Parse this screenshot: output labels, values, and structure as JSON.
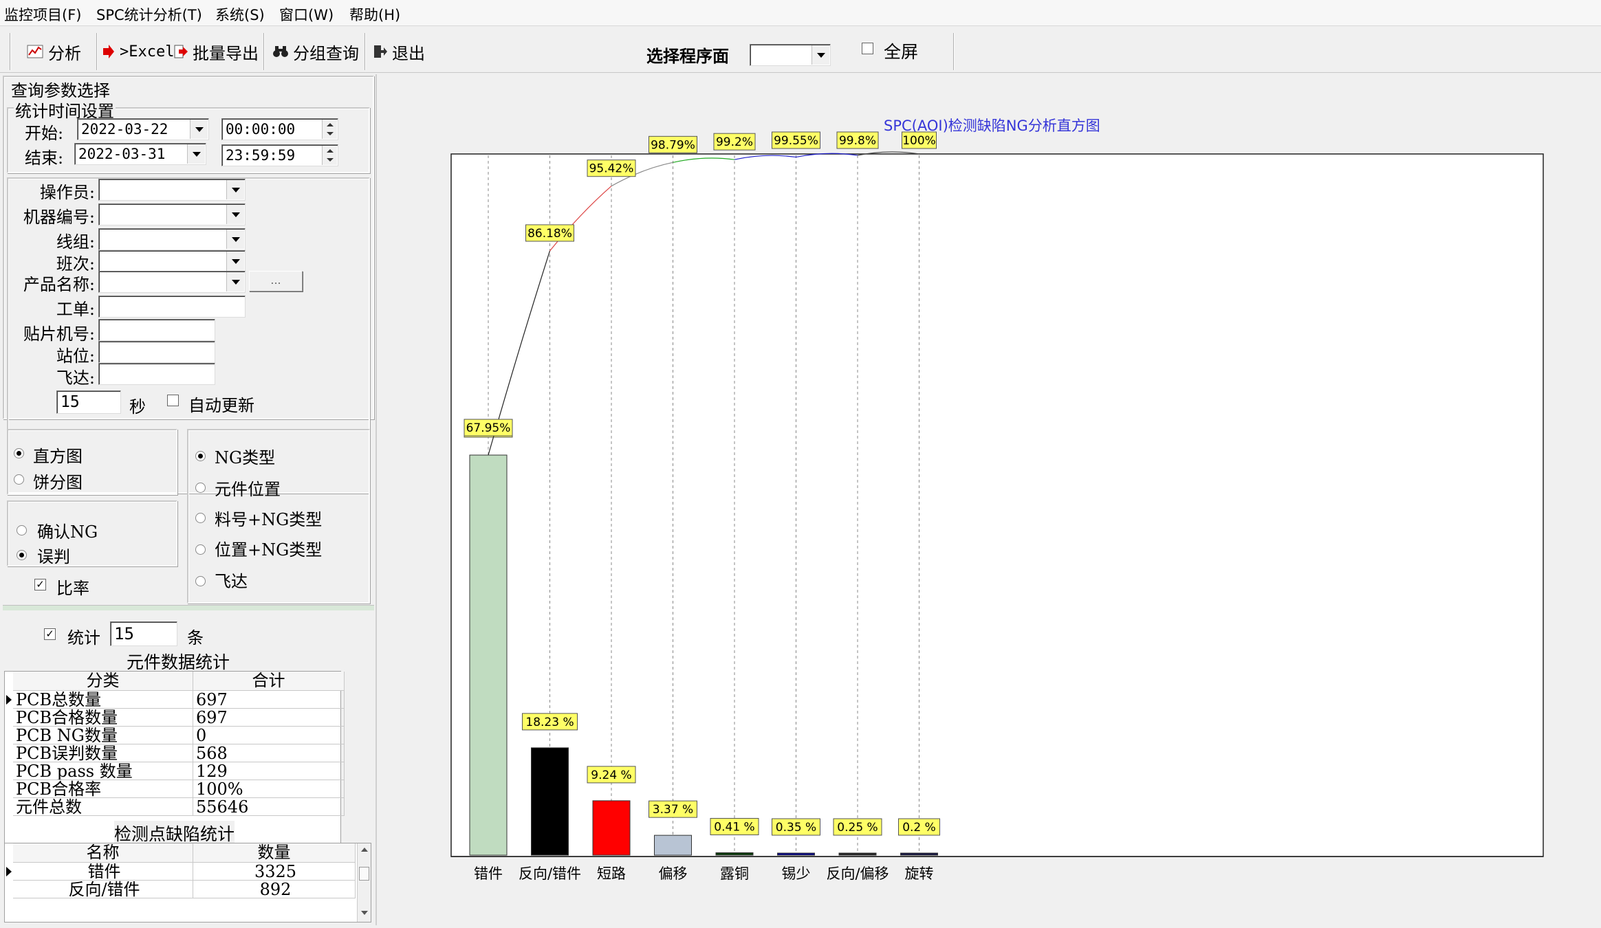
{
  "menu": [
    "监控项目(F)",
    "SPC统计分析(T)",
    "系统(S)",
    "窗口(W)",
    "帮助(H)"
  ],
  "toolbar": {
    "analyze": "分析",
    "excel": ">Excel",
    "batch_export": "批量导出",
    "group_query": "分组查询",
    "exit": "退出",
    "program_side_label": "选择程序面",
    "program_side_value": "",
    "fullscreen_label": "全屏",
    "fullscreen_checked": false
  },
  "query": {
    "title": "查询参数选择",
    "time_title": "统计时间设置",
    "start_label": "开始:",
    "start_date": "2022-03-22",
    "start_time": "00:00:00",
    "end_label": "结束:",
    "end_date": "2022-03-31",
    "end_time": "23:59:59",
    "fields": [
      {
        "label": "操作员:",
        "type": "select",
        "value": ""
      },
      {
        "label": "机器编号:",
        "type": "select",
        "value": ""
      },
      {
        "label": "线组:",
        "type": "select",
        "value": ""
      },
      {
        "label": "班次:",
        "type": "select",
        "value": ""
      },
      {
        "label": "产品名称:",
        "type": "select",
        "value": ""
      },
      {
        "label": "工单:",
        "type": "text",
        "value": ""
      },
      {
        "label": "贴片机号:",
        "type": "text",
        "value": ""
      },
      {
        "label": "站位:",
        "type": "text",
        "value": ""
      },
      {
        "label": "飞达:",
        "type": "text",
        "value": ""
      }
    ],
    "browse_btn": "...",
    "refresh_seconds": "15",
    "seconds_label": "秒",
    "auto_refresh_label": "自动更新",
    "auto_refresh_checked": false
  },
  "options": {
    "chart_types": [
      {
        "label": "直方图",
        "selected": true
      },
      {
        "label": "饼分图",
        "selected": false
      }
    ],
    "ng_modes": [
      {
        "label": "确认NG",
        "selected": false
      },
      {
        "label": "误判",
        "selected": true
      }
    ],
    "ratio_label": "比率",
    "ratio_checked": true,
    "group_by": [
      {
        "label": "NG类型",
        "selected": true
      },
      {
        "label": "元件位置",
        "selected": false
      },
      {
        "label": "料号+NG类型",
        "selected": false
      },
      {
        "label": "位置+NG类型",
        "selected": false
      },
      {
        "label": "飞达",
        "selected": false
      }
    ]
  },
  "stats": {
    "count_label": "统计",
    "count_value": "15",
    "count_unit": "条",
    "count_checked": true,
    "component_title": "元件数据统计",
    "component_headers": [
      "分类",
      "合计"
    ],
    "component_rows": [
      [
        "PCB总数量",
        "697"
      ],
      [
        "PCB合格数量",
        "697"
      ],
      [
        "PCB NG数量",
        "0"
      ],
      [
        "PCB误判数量",
        "568"
      ],
      [
        "PCB pass 数量",
        "129"
      ],
      [
        "PCB合格率",
        "100%"
      ],
      [
        "元件总数",
        "55646"
      ]
    ],
    "defect_title": "检测点缺陷统计",
    "defect_headers": [
      "名称",
      "数量"
    ],
    "defect_rows": [
      [
        "错件",
        "3325"
      ],
      [
        "反向/错件",
        "892"
      ]
    ]
  },
  "chart_data": {
    "type": "bar",
    "title": "SPC(AOI)检测缺陷NG分析直方图",
    "categories": [
      "错件",
      "反向/错件",
      "短路",
      "偏移",
      "露铜",
      "锡少",
      "反向/偏移",
      "旋转"
    ],
    "values": [
      67.95,
      18.23,
      9.24,
      3.37,
      0.41,
      0.35,
      0.25,
      0.2
    ],
    "value_labels": [
      "67.95%",
      "18.23 %",
      "9.24 %",
      "3.37 %",
      "0.41 %",
      "0.35 %",
      "0.25 %",
      "0.2 %"
    ],
    "cumulative": [
      67.95,
      86.18,
      95.42,
      98.79,
      99.2,
      99.55,
      99.8,
      100
    ],
    "cumulative_labels": [
      "67.95%",
      "86.18%",
      "95.42%",
      "98.79%",
      "99.2%",
      "99.55%",
      "99.8%",
      "100%"
    ],
    "colors": [
      "#c0dcc0",
      "#000000",
      "#ff0000",
      "#b8c4d4",
      "#0b3d0b",
      "#00008b",
      "#202020",
      "#101040"
    ],
    "ylim": [
      0,
      100
    ],
    "grid": false,
    "label_bg": "#ffff66"
  }
}
